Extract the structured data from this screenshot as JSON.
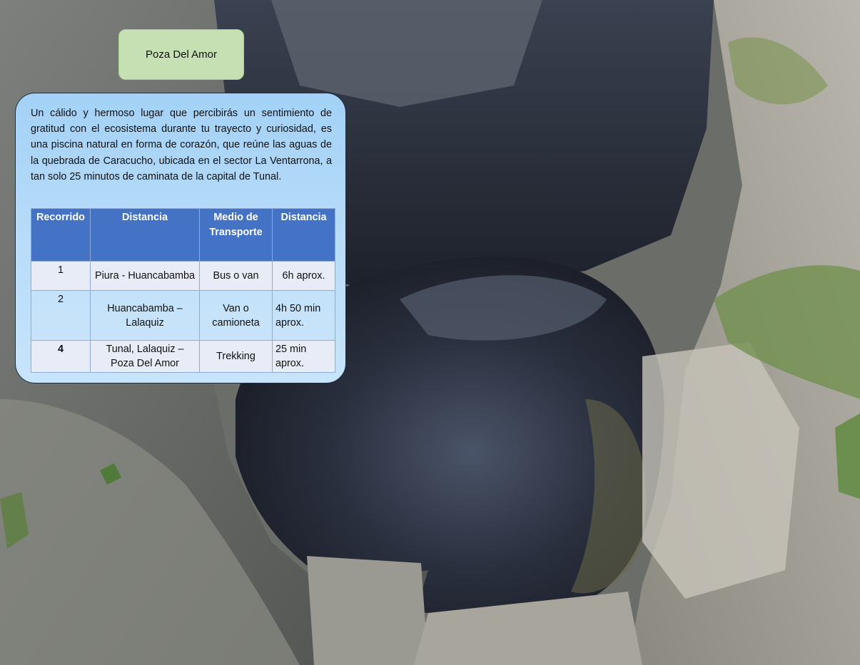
{
  "title": "Poza Del Amor",
  "description": "Un cálido y hermoso lugar que percibirás un sentimiento de gratitud con el ecosistema durante tu trayecto y curiosidad, es una piscina natural en forma de corazón, que reúne las aguas de la quebrada de Caracucho, ubicada en el sector La Ventarrona, a tan solo 25 minutos de caminata de la capital de Tunal.",
  "table": {
    "headers": [
      "Recorrido",
      "Distancia",
      "Medio de Transporte",
      "Distancia"
    ],
    "rows": [
      [
        "1",
        "Piura - Huancabamba",
        "Bus o van",
        "6h aprox."
      ],
      [
        "2",
        "Huancabamba – Lalaquiz",
        "Van o camioneta",
        "4h 50 min aprox."
      ],
      [
        "4",
        "Tunal, Lalaquiz – Poza Del Amor",
        "Trekking",
        "25 min aprox."
      ]
    ]
  },
  "colors": {
    "badge": "#c6e0b4",
    "card": "#a3d1f7",
    "table_header": "#4472c4"
  }
}
